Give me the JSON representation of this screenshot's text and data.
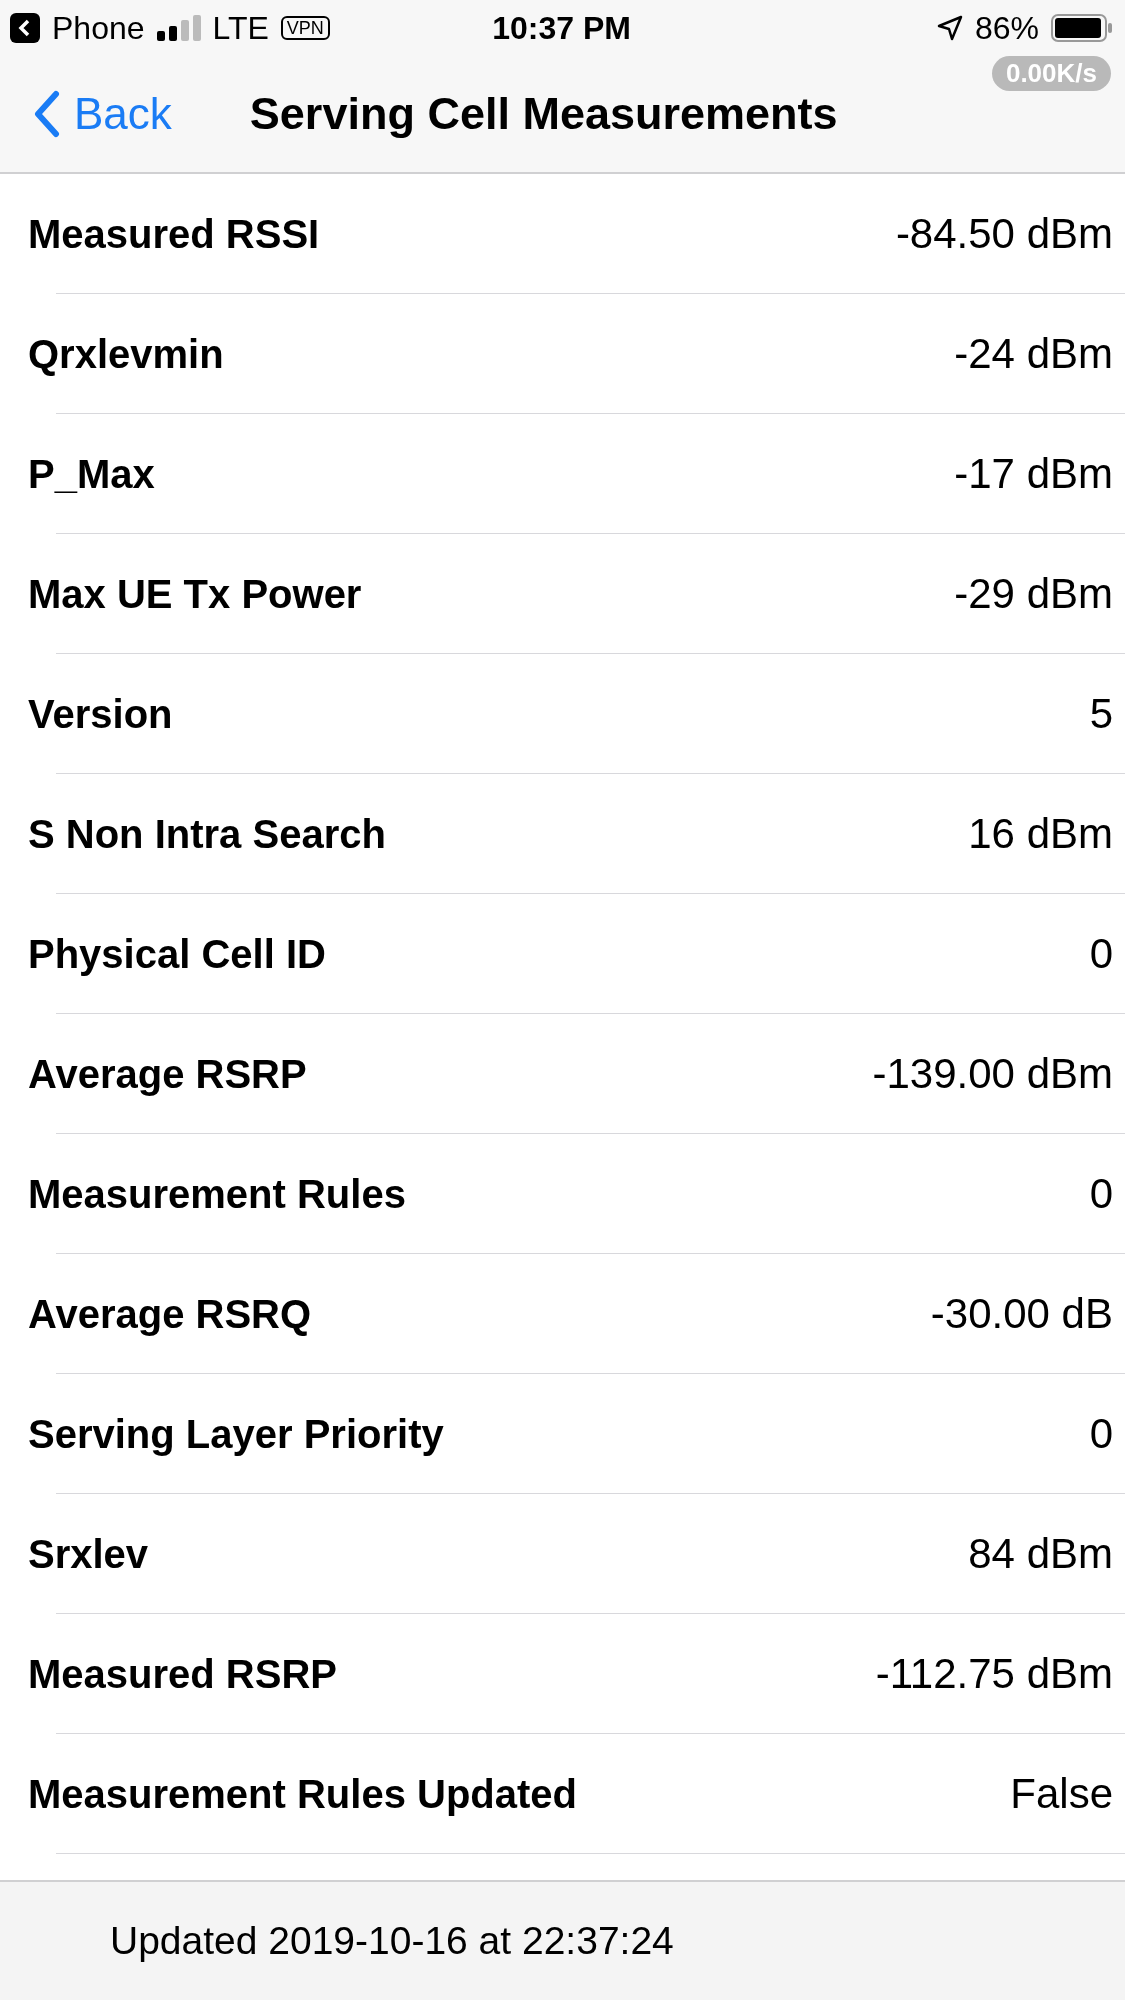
{
  "status_bar": {
    "back_app": "Phone",
    "carrier": "LTE",
    "vpn": "VPN",
    "time": "10:37 PM",
    "battery": "86%",
    "speed": "0.00K/s"
  },
  "nav": {
    "back": "Back",
    "title": "Serving Cell Measurements"
  },
  "rows": [
    {
      "label": "Measured RSSI",
      "value": "-84.50 dBm"
    },
    {
      "label": "Qrxlevmin",
      "value": "-24 dBm"
    },
    {
      "label": "P_Max",
      "value": "-17 dBm"
    },
    {
      "label": "Max UE Tx Power",
      "value": "-29 dBm"
    },
    {
      "label": "Version",
      "value": "5"
    },
    {
      "label": "S Non Intra Search",
      "value": "16 dBm"
    },
    {
      "label": "Physical Cell ID",
      "value": "0"
    },
    {
      "label": "Average RSRP",
      "value": "-139.00 dBm"
    },
    {
      "label": "Measurement Rules",
      "value": "0"
    },
    {
      "label": "Average RSRQ",
      "value": "-30.00 dB"
    },
    {
      "label": "Serving Layer Priority",
      "value": "0"
    },
    {
      "label": "Srxlev",
      "value": "84 dBm"
    },
    {
      "label": "Measured RSRP",
      "value": "-112.75 dBm"
    },
    {
      "label": "Measurement Rules Updated",
      "value": "False"
    }
  ],
  "footer": {
    "updated": "Updated 2019-10-16 at 22:37:24"
  }
}
